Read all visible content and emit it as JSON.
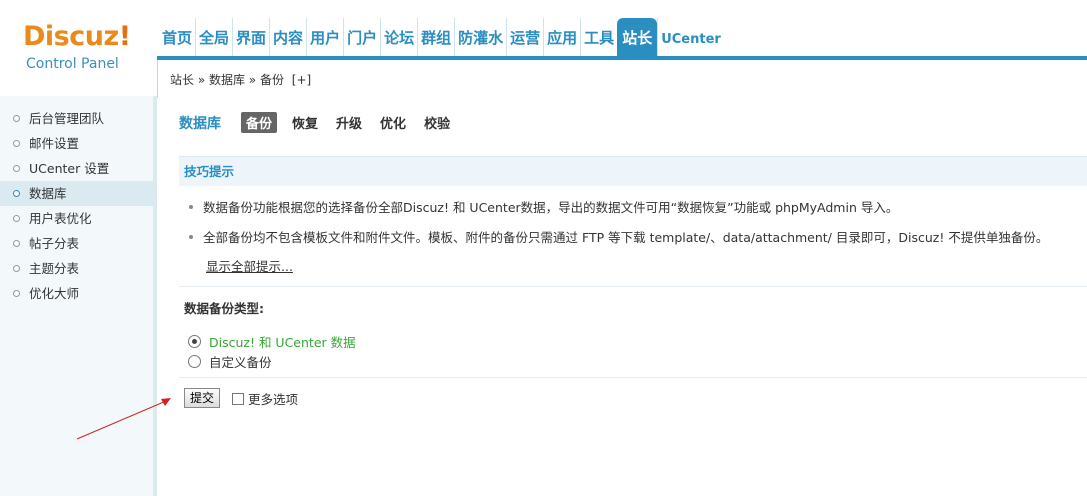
{
  "logo": {
    "brand_text": "Discuz",
    "brand_bang": "!",
    "subtitle": "Control Panel"
  },
  "nav": {
    "items": [
      {
        "label": "首页",
        "active": false
      },
      {
        "label": "全局",
        "active": false
      },
      {
        "label": "界面",
        "active": false
      },
      {
        "label": "内容",
        "active": false
      },
      {
        "label": "用户",
        "active": false
      },
      {
        "label": "门户",
        "active": false
      },
      {
        "label": "论坛",
        "active": false
      },
      {
        "label": "群组",
        "active": false
      },
      {
        "label": "防灌水",
        "active": false
      },
      {
        "label": "运营",
        "active": false
      },
      {
        "label": "应用",
        "active": false
      },
      {
        "label": "工具",
        "active": false
      },
      {
        "label": "站长",
        "active": true
      },
      {
        "label": "UCenter",
        "active": false
      }
    ],
    "accent_color": "#2a8ec1"
  },
  "breadcrumb": {
    "text": "站长 » 数据库 » 备份",
    "plus": "[+]"
  },
  "sidebar": {
    "items": [
      {
        "label": "后台管理团队",
        "active": false
      },
      {
        "label": "邮件设置",
        "active": false
      },
      {
        "label": "UCenter 设置",
        "active": false
      },
      {
        "label": "数据库",
        "active": true
      },
      {
        "label": "用户表优化",
        "active": false
      },
      {
        "label": "帖子分表",
        "active": false
      },
      {
        "label": "主题分表",
        "active": false
      },
      {
        "label": "优化大师",
        "active": false
      }
    ]
  },
  "main": {
    "section_title": "数据库",
    "tabs": [
      {
        "label": "备份",
        "active": true
      },
      {
        "label": "恢复",
        "active": false
      },
      {
        "label": "升级",
        "active": false
      },
      {
        "label": "优化",
        "active": false
      },
      {
        "label": "校验",
        "active": false
      }
    ],
    "tips_title": "技巧提示",
    "tip1": "数据备份功能根据您的选择备份全部Discuz! 和 UCenter数据，导出的数据文件可用“数据恢复”功能或 phpMyAdmin 导入。",
    "tip2": "全部备份均不包含模板文件和附件文件。模板、附件的备份只需通过 FTP 等下载 template/、data/attachment/ 目录即可，Discuz! 不提供单独备份。",
    "show_all": "显示全部提示...",
    "backup_type_label": "数据备份类型:",
    "options": [
      {
        "label": "Discuz! 和 UCenter 数据",
        "checked": true
      },
      {
        "label": "自定义备份",
        "checked": false
      }
    ],
    "submit_label": "提交",
    "more_options_label": "更多选项"
  }
}
